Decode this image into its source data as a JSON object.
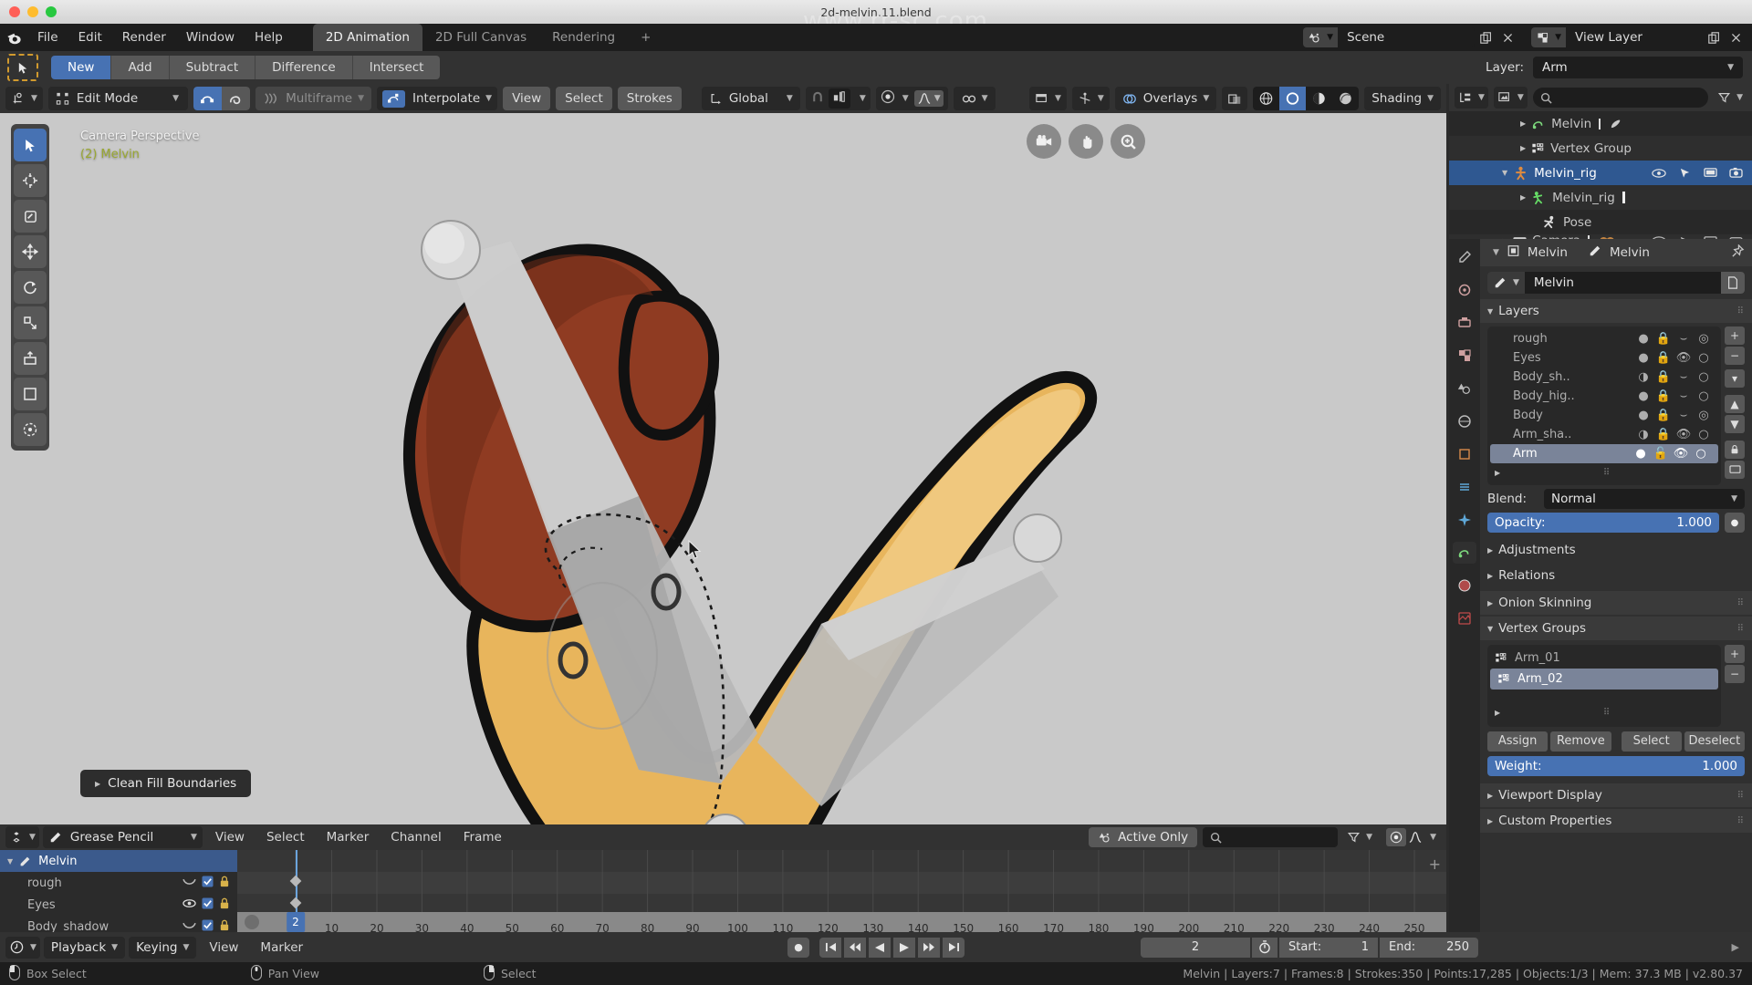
{
  "titlebar": {
    "filename": "2d-melvin.11.blend",
    "watermark": "www.rr-sc.com"
  },
  "topbar": {
    "logo_icon": "blender-logo-icon",
    "menus": [
      "File",
      "Edit",
      "Render",
      "Window",
      "Help"
    ],
    "workspaces": [
      {
        "label": "2D Animation",
        "active": true
      },
      {
        "label": "2D Full Canvas",
        "active": false
      },
      {
        "label": "Rendering",
        "active": false
      },
      {
        "label": "+",
        "active": false
      }
    ],
    "scene": {
      "icon": "scene-icon",
      "value": "Scene",
      "copy_icon": "duplicate-icon",
      "close_icon": "close-icon"
    },
    "view_layer": {
      "icon": "view-layer-icon",
      "value": "View Layer",
      "copy_icon": "duplicate-icon",
      "close_icon": "close-icon"
    }
  },
  "toolsettings": {
    "tool_icon": "select-box-tool-icon",
    "modes": [
      {
        "label": "New",
        "active": true
      },
      {
        "label": "Add",
        "active": false
      },
      {
        "label": "Subtract",
        "active": false
      },
      {
        "label": "Difference",
        "active": false
      },
      {
        "label": "Intersect",
        "active": false
      }
    ]
  },
  "viewport_header": {
    "editor_icon": "editor-type-icon",
    "mode": "Edit Mode",
    "toggle_icons": [
      "gpencil-edit-points-icon",
      "gpencil-edit-strokes-icon"
    ],
    "multiframe": "Multiframe",
    "interpolate": "Interpolate",
    "menus": [
      "View",
      "Select",
      "Strokes"
    ],
    "orientation": "Global",
    "snap_icon": "snap-magnet-icon",
    "proportional_icon": "proportional-editing-icon",
    "falloff_icon": "falloff-curve-icon",
    "mirror_icon": "mirror-icon",
    "visibility_icon": "object-types-visibility-icon",
    "gizmo_icon": "gizmo-icon",
    "overlays": "Overlays",
    "xray_icon": "xray-icon",
    "shading_modes": [
      "wireframe-icon",
      "solid-icon",
      "material-preview-icon",
      "rendered-icon"
    ],
    "shading_active_index": 1,
    "shading": "Shading"
  },
  "viewport": {
    "view_label": "Camera Perspective",
    "object_label": "(2) Melvin",
    "operator_panel": "Clean Fill Boundaries",
    "toolshelf_icons": [
      "tweak-select-tool-icon",
      "cursor-tool-icon",
      "annotate-tool-icon",
      "move-tool-icon",
      "rotate-tool-icon",
      "scale-tool-icon",
      "extrude-tool-icon",
      "radius-tool-icon",
      "bend-tool-icon"
    ],
    "nav_icons": [
      "camera-view-icon",
      "pan-view-icon",
      "zoom-view-icon"
    ]
  },
  "outliner": {
    "display_mode_icon": "outliner-display-mode-icon",
    "filter_scene_icon": "scene-collection-icon",
    "search_icon": "search-icon",
    "search_value": "",
    "filter_icon": "filter-funnel-icon",
    "rows": [
      {
        "indent": 3,
        "expand": "collapsed",
        "icon": "grease-pencil-data-icon",
        "label": "Melvin",
        "selected": false,
        "eyes": []
      },
      {
        "indent": 3,
        "expand": "collapsed",
        "icon": "vertex-group-icon",
        "label": "Vertex Group",
        "selected": false,
        "eyes": []
      },
      {
        "indent": 2,
        "expand": "expanded",
        "icon": "armature-object-icon",
        "label": "Melvin_rig",
        "selected": true,
        "eyes": [
          "eye-icon",
          "cursor-arrow-icon",
          "monitor-icon",
          "camera-icon"
        ]
      },
      {
        "indent": 3,
        "expand": "collapsed",
        "icon": "armature-data-icon",
        "label": "Melvin_rig",
        "selected": false,
        "eyes": []
      },
      {
        "indent": 4,
        "expand": "none",
        "icon": "pose-icon",
        "label": "Pose",
        "selected": false,
        "eyes": []
      },
      {
        "indent": 2,
        "expand": "collapsed",
        "icon": "camera-data-icon",
        "label": "Camera",
        "selected": false,
        "eyes": [
          "eye-icon",
          "cursor-arrow-icon",
          "monitor-icon",
          "camera-icon"
        ]
      }
    ]
  },
  "properties": {
    "tabs": [
      "tool-tab-icon",
      "render-tab-icon",
      "output-tab-icon",
      "view-layer-tab-icon",
      "scene-tab-icon",
      "world-tab-icon",
      "object-tab-icon",
      "modifier-tab-icon",
      "visual-effects-tab-icon",
      "object-data-tab-icon",
      "material-tab-icon",
      "texture-tab-icon"
    ],
    "active_tab_index": 9,
    "breadcrumb": {
      "object_icon": "object-icon",
      "object": "Melvin",
      "data_icon": "grease-pencil-icon",
      "data": "Melvin",
      "pin_icon": "pin-icon"
    },
    "datablock": {
      "icon": "grease-pencil-icon",
      "value": "Melvin",
      "new_icon": "new-data-icon"
    },
    "layers_panel": {
      "title": "Layers",
      "items": [
        {
          "name": "rough",
          "onion": "dot",
          "lock": "locked",
          "mask": "curve",
          "onion2": "onion-double",
          "selected": false
        },
        {
          "name": "Eyes",
          "onion": "dot",
          "lock": "locked",
          "mask": "eye",
          "onion2": "circle",
          "selected": false
        },
        {
          "name": "Body_sh..",
          "onion": "half",
          "lock": "locked",
          "mask": "curve",
          "onion2": "circle",
          "selected": false
        },
        {
          "name": "Body_hig..",
          "onion": "dot",
          "lock": "locked",
          "mask": "curve",
          "onion2": "circle",
          "selected": false
        },
        {
          "name": "Body",
          "onion": "dot",
          "lock": "locked",
          "mask": "curve",
          "onion2": "onion-double",
          "selected": false
        },
        {
          "name": "Arm_sha..",
          "onion": "half",
          "lock": "locked",
          "mask": "eye",
          "onion2": "circle",
          "selected": false
        },
        {
          "name": "Arm",
          "onion": "dot",
          "lock": "unlocked",
          "mask": "eye",
          "onion2": "circle",
          "selected": true
        }
      ],
      "side_buttons": [
        "+",
        "−",
        "v",
        "▲",
        "▼",
        "lock-icon",
        "monitor-icon"
      ]
    },
    "blend": {
      "label": "Blend:",
      "value": "Normal"
    },
    "opacity": {
      "label": "Opacity:",
      "value": "1.000",
      "anim_icon": "animate-property-icon"
    },
    "subpanels": [
      "Adjustments",
      "Relations",
      "Onion Skinning"
    ],
    "vertex_groups": {
      "title": "Vertex Groups",
      "items": [
        {
          "name": "Arm_01",
          "selected": false
        },
        {
          "name": "Arm_02",
          "selected": true
        }
      ],
      "side_buttons": [
        "+",
        "−"
      ],
      "actions": [
        "Assign",
        "Remove",
        "Select",
        "Deselect"
      ],
      "weight": {
        "label": "Weight:",
        "value": "1.000"
      }
    },
    "bottom_panels": [
      "Viewport Display",
      "Custom Properties"
    ]
  },
  "dopesheet": {
    "editor_icon": "dopesheet-editor-icon",
    "mode_icon": "grease-pencil-icon",
    "mode": "Grease Pencil",
    "menus": [
      "View",
      "Select",
      "Marker",
      "Channel",
      "Frame"
    ],
    "active_only": {
      "icon": "scene-icon",
      "label": "Active Only"
    },
    "search_icon": "search-icon",
    "search_value": "",
    "filter_icon": "filter-funnel-icon",
    "proportional_icon": "proportional-editing-icon",
    "falloff_icon": "falloff-curve-icon",
    "channels": [
      {
        "label": "Melvin",
        "type": "group",
        "expand": "expanded",
        "icon": "grease-pencil-icon",
        "selected": true,
        "mask": null,
        "check": null,
        "lock": null
      },
      {
        "label": "rough",
        "type": "layer",
        "expand": "none",
        "icon": null,
        "selected": false,
        "mask": "curve",
        "check": true,
        "lock": "locked"
      },
      {
        "label": "Eyes",
        "type": "layer",
        "expand": "none",
        "icon": null,
        "selected": false,
        "mask": "eye",
        "check": true,
        "lock": "locked"
      },
      {
        "label": "Body_shadow",
        "type": "layer",
        "expand": "none",
        "icon": null,
        "selected": false,
        "mask": "curve",
        "check": true,
        "lock": "locked"
      }
    ],
    "ruler_ticks": [
      2,
      10,
      20,
      30,
      40,
      50,
      60,
      70,
      80,
      90,
      100,
      110,
      120,
      130,
      140,
      150,
      160,
      170,
      180,
      190,
      200,
      210,
      220,
      230,
      240,
      250
    ],
    "current_frame": 2,
    "keyframes_at_frame": 2
  },
  "timeline_bar": {
    "editor_icon": "timeline-editor-icon",
    "menus": [
      "Playback",
      "Keying",
      "View",
      "Marker"
    ],
    "transport": [
      "record-icon",
      "jump-start-icon",
      "prev-keyframe-icon",
      "play-reverse-icon",
      "play-icon",
      "next-keyframe-icon",
      "jump-end-icon"
    ],
    "frame_current": "2",
    "timer_icon": "auto-keying-icon",
    "start": {
      "label": "Start:",
      "value": "1"
    },
    "end": {
      "label": "End:",
      "value": "250"
    }
  },
  "statusbar": {
    "items": [
      {
        "icon": "mouse-left-icon",
        "label": "Box Select"
      },
      {
        "icon": "mouse-middle-icon",
        "label": "Pan View"
      },
      {
        "icon": "mouse-right-icon",
        "label": "Select"
      }
    ],
    "stats": "Melvin | Layers:7 | Frames:8 | Strokes:350 | Points:17,285 | Objects:1/3 | Mem: 37.3 MB | v2.80.37"
  },
  "layer_selector": {
    "label": "Layer:",
    "value": "Arm"
  },
  "colors": {
    "accent_blue": "#4772b3",
    "selection_blue": "#2f5891",
    "panel_bg": "#303030",
    "header_bg": "#323232",
    "viewport_bg": "#c9c9c9",
    "art_orange": "#e8b55c",
    "art_brown": "#8f3b22",
    "art_gray": "#b5b5b5"
  }
}
